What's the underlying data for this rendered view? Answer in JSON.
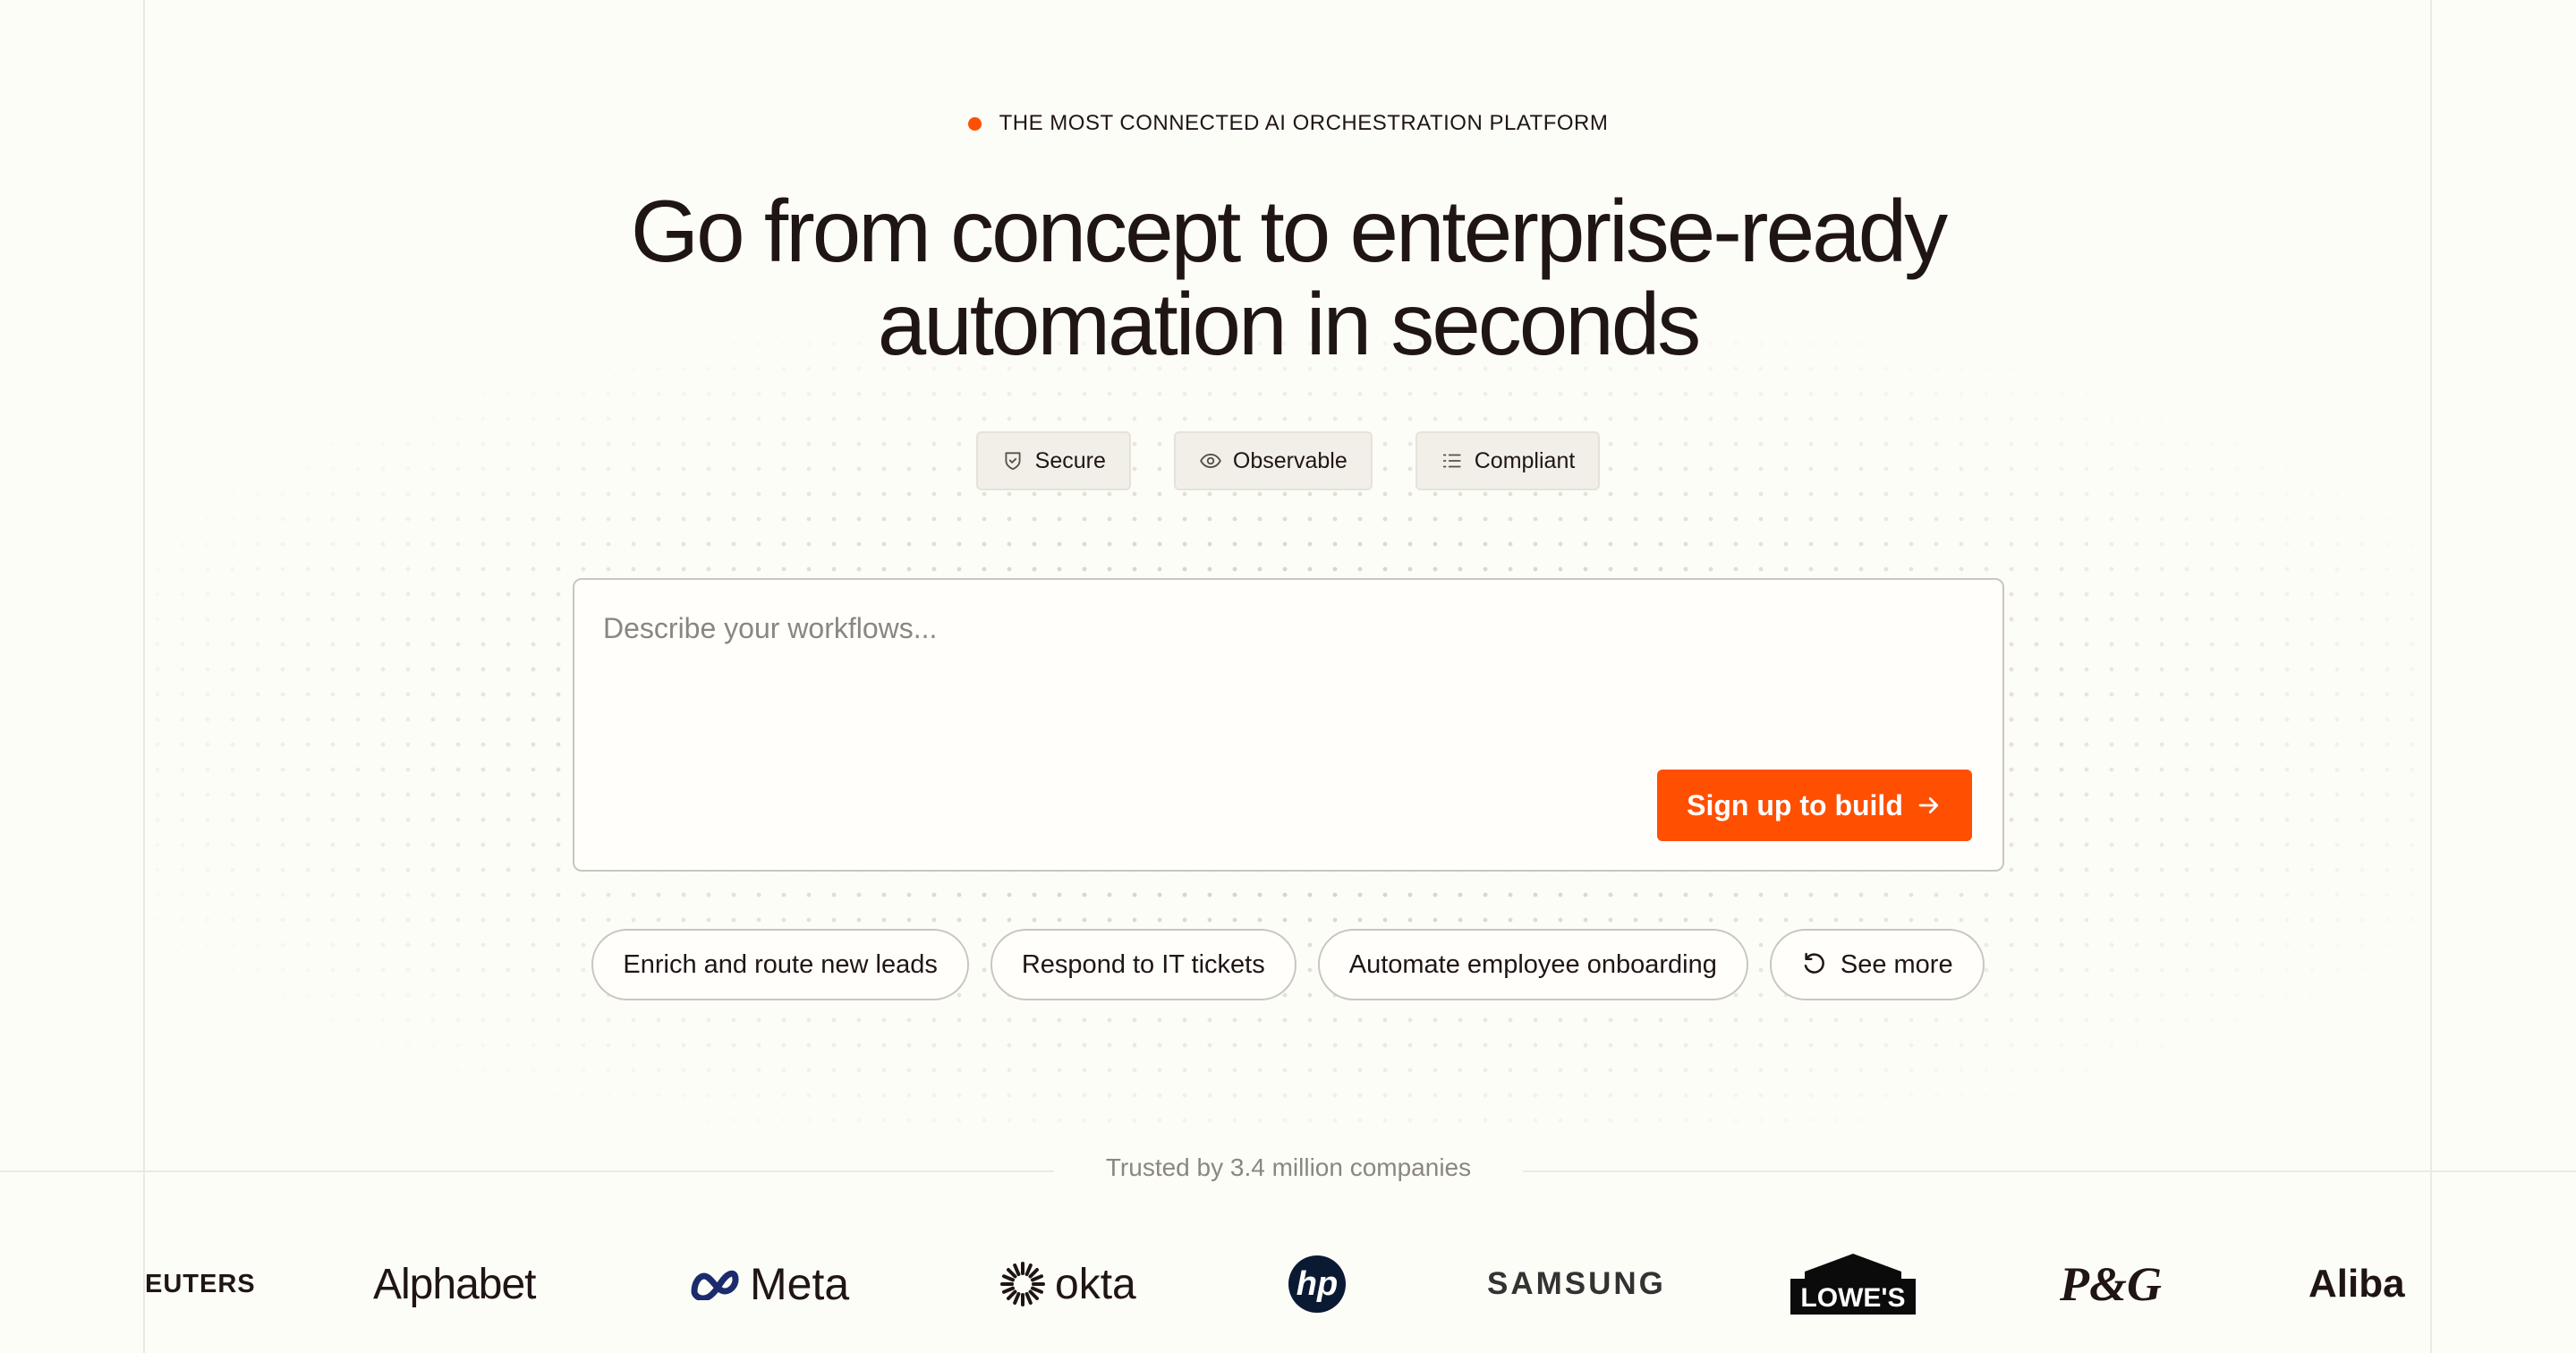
{
  "eyebrow": {
    "text": "THE MOST CONNECTED AI ORCHESTRATION PLATFORM",
    "dot_color": "#ff4f00"
  },
  "headline": {
    "line1": "Go from concept to enterprise-ready",
    "line2": "automation in seconds"
  },
  "features": [
    {
      "label": "Secure",
      "icon": "shield-icon"
    },
    {
      "label": "Observable",
      "icon": "eye-icon"
    },
    {
      "label": "Compliant",
      "icon": "list-icon"
    }
  ],
  "prompt": {
    "placeholder": "Describe your workflows...",
    "value": "",
    "submit_label": "Sign up to build",
    "submit_icon": "arrow-right-icon"
  },
  "suggestions": [
    {
      "label": "Enrich and route new leads"
    },
    {
      "label": "Respond to IT tickets"
    },
    {
      "label": "Automate employee onboarding"
    },
    {
      "label": "See more",
      "icon": "refresh-icon"
    }
  ],
  "trusted": {
    "text": "Trusted by 3.4 million companies"
  },
  "logos": [
    {
      "name": "REUTERS",
      "visible_text": "EUTERS"
    },
    {
      "name": "Alphabet",
      "visible_text": "Alphabet"
    },
    {
      "name": "Meta",
      "visible_text": "Meta"
    },
    {
      "name": "okta",
      "visible_text": "okta"
    },
    {
      "name": "hp",
      "visible_text": "hp"
    },
    {
      "name": "SAMSUNG",
      "visible_text": "SAMSUNG"
    },
    {
      "name": "LOWE'S",
      "visible_text": "LOWE'S"
    },
    {
      "name": "P&G",
      "visible_text": "P&G"
    },
    {
      "name": "Alibaba",
      "visible_text": "Aliba"
    }
  ],
  "colors": {
    "accent": "#ff4f00",
    "background": "#fdfdf8",
    "text": "#201515",
    "muted": "#8a8680"
  }
}
